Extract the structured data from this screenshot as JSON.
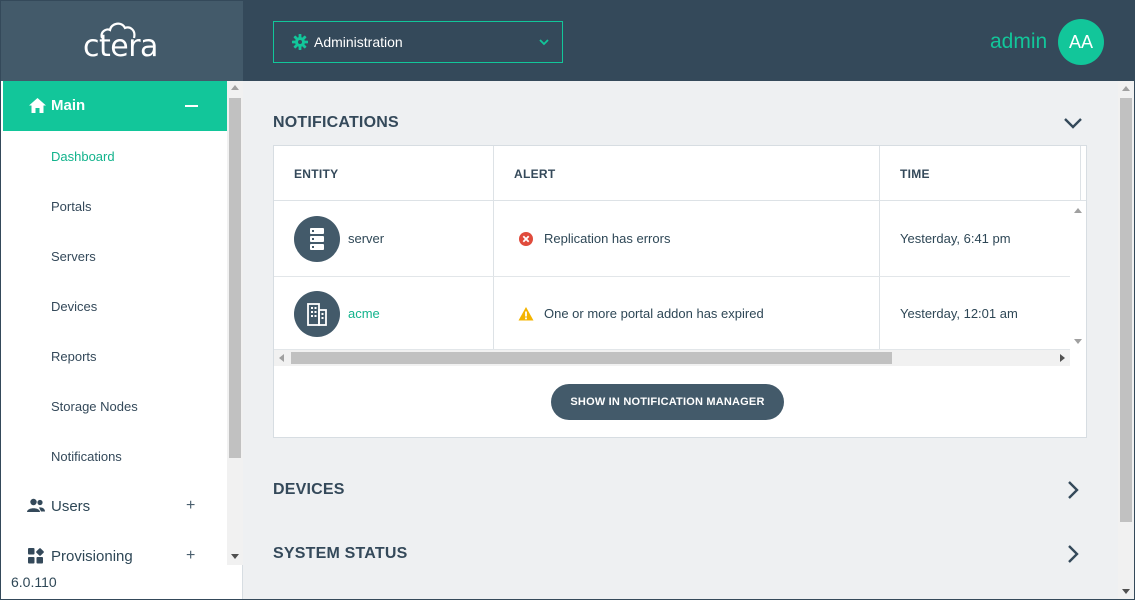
{
  "brand": {
    "logo_text": "ctera"
  },
  "header": {
    "selector_label": "Administration",
    "username": "admin",
    "avatar_initials": "AA"
  },
  "sidebar": {
    "main": {
      "label": "Main",
      "icon": "home-icon"
    },
    "items": [
      {
        "label": "Dashboard",
        "active": true
      },
      {
        "label": "Portals"
      },
      {
        "label": "Servers"
      },
      {
        "label": "Devices"
      },
      {
        "label": "Reports"
      },
      {
        "label": "Storage Nodes"
      },
      {
        "label": "Notifications"
      }
    ],
    "groups": [
      {
        "label": "Users",
        "icon": "users-icon"
      },
      {
        "label": "Provisioning",
        "icon": "grid-icon"
      }
    ],
    "version": "6.0.110"
  },
  "notifications": {
    "title": "NOTIFICATIONS",
    "columns": [
      "ENTITY",
      "ALERT",
      "TIME"
    ],
    "rows": [
      {
        "entity": "server",
        "entity_icon": "server-icon",
        "alert": "Replication has errors",
        "alert_icon": "error-icon",
        "time": "Yesterday, 6:41 pm"
      },
      {
        "entity": "acme",
        "entity_icon": "building-icon",
        "alert": "One or more portal addon has expired",
        "alert_icon": "warning-icon",
        "time": "Yesterday, 12:01 am"
      }
    ],
    "button_label": "SHOW IN NOTIFICATION MANAGER"
  },
  "devices": {
    "title": "DEVICES"
  },
  "system_status": {
    "title": "SYSTEM STATUS"
  },
  "colors": {
    "accent": "#12c69a",
    "header_bg": "#34495a",
    "logo_bg": "#435a6a",
    "content_bg": "#eef0f2",
    "error": "#e04b3c",
    "warning": "#f4b400"
  }
}
